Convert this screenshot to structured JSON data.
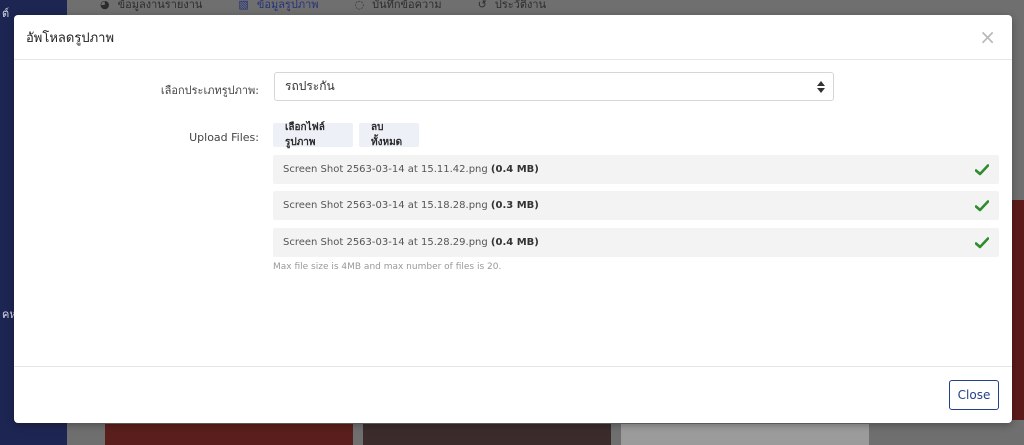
{
  "background": {
    "sidebar_top_text": "ต์",
    "sidebar_mid_text": "คห",
    "tabs": [
      {
        "label": "ข้อมูลงานรายงาน",
        "icon": "palette-icon",
        "active": false
      },
      {
        "label": "ข้อมูลรูปภาพ",
        "icon": "image-icon",
        "active": true
      },
      {
        "label": "บันทึกข้อความ",
        "icon": "chat-icon",
        "active": false
      },
      {
        "label": "ประวัติงาน",
        "icon": "history-icon",
        "active": false
      }
    ]
  },
  "modal": {
    "title": "อัพโหลดรูปภาพ",
    "image_type_label": "เลือกประเภทรูปภาพ:",
    "image_type_value": "รถประกัน",
    "upload_label": "Upload Files:",
    "choose_button": "เลือกไฟล์รูปภาพ",
    "clear_button": "ลบทั้งหมด",
    "files": [
      {
        "name": "Screen Shot 2563-03-14 at 15.11.42.png",
        "size": "(0.4 MB)"
      },
      {
        "name": "Screen Shot 2563-03-14 at 15.18.28.png",
        "size": "(0.3 MB)"
      },
      {
        "name": "Screen Shot 2563-03-14 at 15.28.29.png",
        "size": "(0.4 MB)"
      }
    ],
    "hint": "Max file size is 4MB and max number of files is 20.",
    "close_button": "Close"
  },
  "colors": {
    "accent": "#24408a",
    "check": "#2e8b2e",
    "sidebar": "#1d2552"
  }
}
